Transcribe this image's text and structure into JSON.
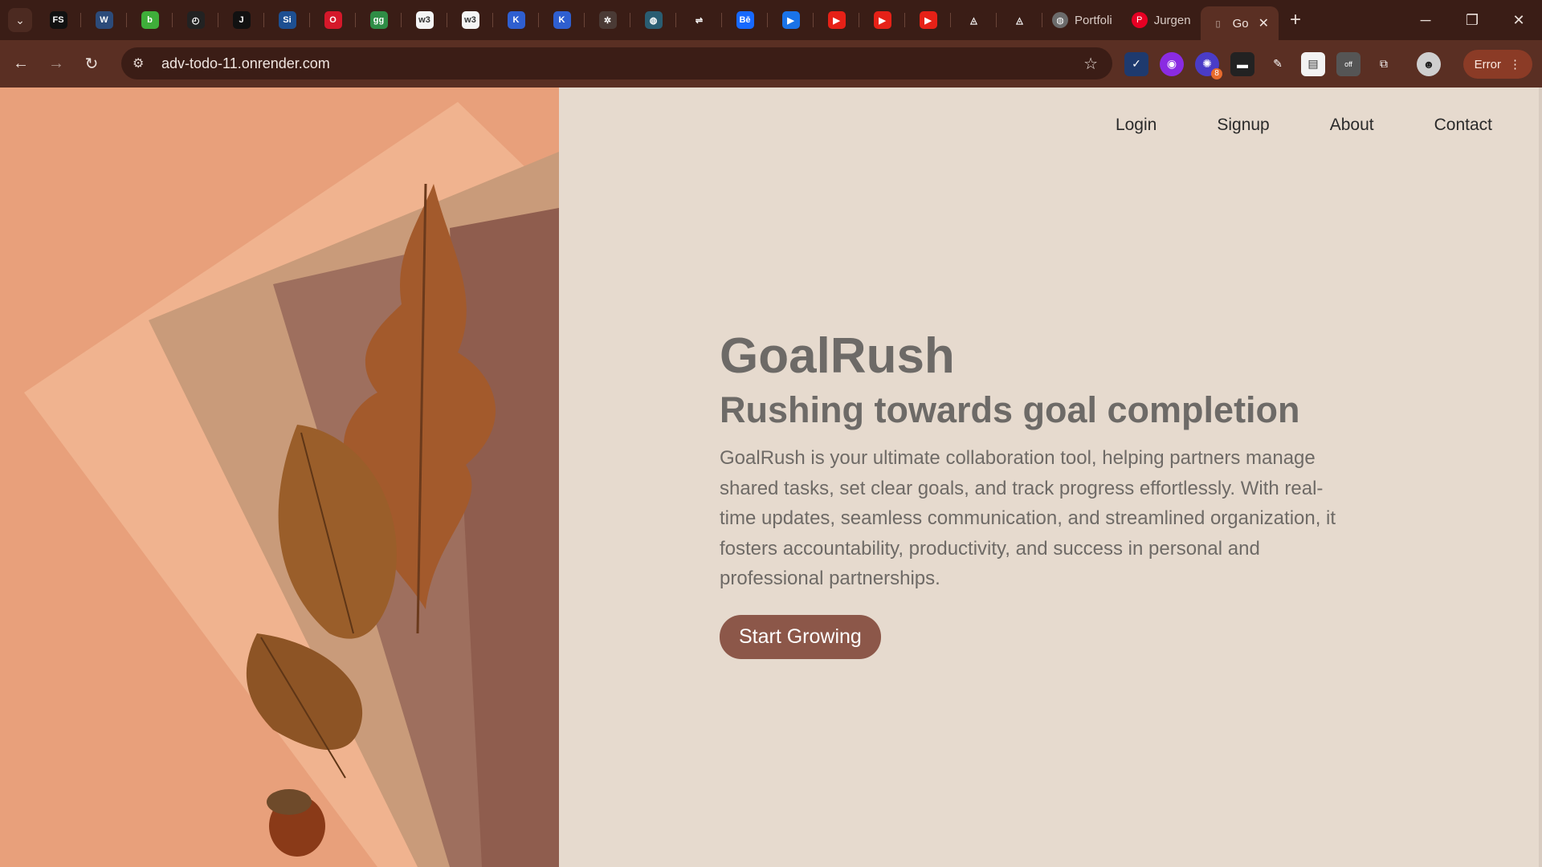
{
  "browser": {
    "pinned_tabs": [
      {
        "icon": "fs-favicon",
        "text": "FS",
        "bg": "#111111"
      },
      {
        "icon": "wave-favicon",
        "text": "W",
        "bg": "#2c4b7a"
      },
      {
        "icon": "green-circle-favicon",
        "text": "b",
        "bg": "#3fae3a"
      },
      {
        "icon": "clock-favicon",
        "text": "◴",
        "bg": "#222222"
      },
      {
        "icon": "j-favicon",
        "text": "J",
        "bg": "#111111"
      },
      {
        "icon": "si-favicon",
        "text": "Si",
        "bg": "#1d4f91"
      },
      {
        "icon": "opera-favicon",
        "text": "O",
        "bg": "#d5182a"
      },
      {
        "icon": "gg-favicon",
        "text": "gg",
        "bg": "#2f8d46"
      },
      {
        "icon": "w3-favicon",
        "text": "w3",
        "bg": "#f4f4f4"
      },
      {
        "icon": "w3-favicon-2",
        "text": "w3",
        "bg": "#f4f4f4"
      },
      {
        "icon": "k-favicon",
        "text": "K",
        "bg": "#2f5fd0"
      },
      {
        "icon": "k-favicon-2",
        "text": "K",
        "bg": "#2f5fd0"
      },
      {
        "icon": "network-favicon",
        "text": "✲",
        "bg": "#4a3a35"
      },
      {
        "icon": "globe-favicon",
        "text": "◍",
        "bg": "#2a5d72"
      },
      {
        "icon": "arrow-favicon",
        "text": "⇌",
        "bg": "#3a1d16"
      },
      {
        "icon": "behance-favicon",
        "text": "Bē",
        "bg": "#1769ff"
      },
      {
        "icon": "play-favicon",
        "text": "▶",
        "bg": "#1a73e8"
      },
      {
        "icon": "youtube-favicon",
        "text": "▶",
        "bg": "#e62117"
      },
      {
        "icon": "youtube-favicon-2",
        "text": "▶",
        "bg": "#e62117"
      },
      {
        "icon": "youtube-favicon-3",
        "text": "▶",
        "bg": "#e62117"
      },
      {
        "icon": "triangle-favicon",
        "text": "◬",
        "bg": "#3a1d16"
      },
      {
        "icon": "triangle-favicon-2",
        "text": "◬",
        "bg": "#3a1d16"
      }
    ],
    "tabs": [
      {
        "label": "Portfoli",
        "icon": "globe-icon",
        "active": false
      },
      {
        "label": "Jurgen",
        "icon": "pinterest-icon",
        "active": false
      },
      {
        "label": "Go",
        "icon": "document-icon",
        "active": true
      }
    ],
    "url": "adv-todo-11.onrender.com",
    "error_label": "Error",
    "extension_badge": "8"
  },
  "nav": {
    "items": [
      "Login",
      "Signup",
      "About",
      "Contact"
    ]
  },
  "hero": {
    "brand": "GoalRush",
    "tagline": "Rushing towards goal completion",
    "description": "GoalRush is your ultimate collaboration tool, helping partners manage shared tasks, set clear goals, and track progress effortlessly. With real-time updates, seamless communication, and streamlined organization, it fosters accountability, productivity, and success in personal and professional partnerships.",
    "cta_label": "Start Growing"
  },
  "colors": {
    "accent": "#8c5749",
    "page_bg": "#e6dace",
    "text": "#6d6a67"
  }
}
